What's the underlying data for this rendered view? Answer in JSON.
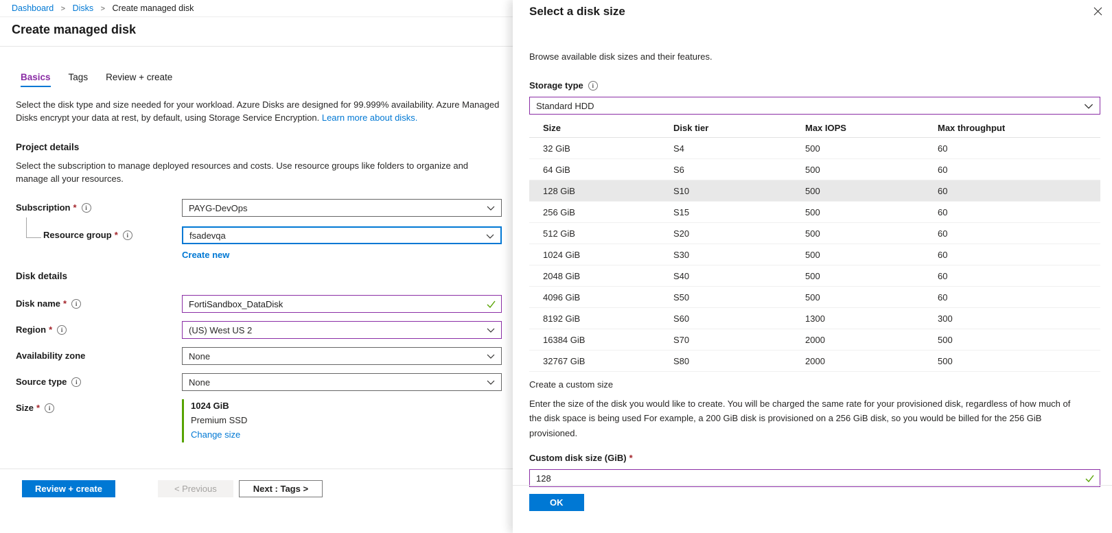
{
  "ui": {
    "required": "*",
    "breadcrumb_separator": ">"
  },
  "breadcrumb": {
    "dashboard": "Dashboard",
    "disks": "Disks",
    "current": "Create managed disk"
  },
  "page": {
    "title": "Create managed disk"
  },
  "tabs": {
    "basics": "Basics",
    "tags": "Tags",
    "review": "Review + create"
  },
  "intro": {
    "text": "Select the disk type and size needed for your workload. Azure Disks are designed for 99.999% availability. Azure Managed Disks encrypt your data at rest, by default, using Storage Service Encryption.",
    "link": "Learn more about disks."
  },
  "project_details": {
    "heading": "Project details",
    "description": "Select the subscription to manage deployed resources and costs. Use resource groups like folders to organize and manage all your resources.",
    "subscription": {
      "label": "Subscription",
      "value": "PAYG-DevOps"
    },
    "resource_group": {
      "label": "Resource group",
      "value": "fsadevqa",
      "create_new": "Create new"
    }
  },
  "disk_details": {
    "heading": "Disk details",
    "disk_name": {
      "label": "Disk name",
      "value": "FortiSandbox_DataDisk"
    },
    "region": {
      "label": "Region",
      "value": "(US) West US 2"
    },
    "availability_zone": {
      "label": "Availability zone",
      "value": "None"
    },
    "source_type": {
      "label": "Source type",
      "value": "None"
    },
    "size": {
      "label": "Size",
      "value": "1024 GiB",
      "tier": "Premium SSD",
      "change_link": "Change size"
    }
  },
  "footer": {
    "review_create": "Review + create",
    "previous": "< Previous",
    "next": "Next : Tags >"
  },
  "panel": {
    "title": "Select a disk size",
    "description": "Browse available disk sizes and their features.",
    "storage_type": {
      "label": "Storage type",
      "value": "Standard HDD"
    },
    "table": {
      "headers": {
        "size": "Size",
        "tier": "Disk tier",
        "iops": "Max IOPS",
        "throughput": "Max throughput"
      },
      "selected_size": "128 GiB",
      "rows": [
        {
          "size": "32 GiB",
          "tier": "S4",
          "iops": "500",
          "throughput": "60"
        },
        {
          "size": "64 GiB",
          "tier": "S6",
          "iops": "500",
          "throughput": "60"
        },
        {
          "size": "128 GiB",
          "tier": "S10",
          "iops": "500",
          "throughput": "60"
        },
        {
          "size": "256 GiB",
          "tier": "S15",
          "iops": "500",
          "throughput": "60"
        },
        {
          "size": "512 GiB",
          "tier": "S20",
          "iops": "500",
          "throughput": "60"
        },
        {
          "size": "1024 GiB",
          "tier": "S30",
          "iops": "500",
          "throughput": "60"
        },
        {
          "size": "2048 GiB",
          "tier": "S40",
          "iops": "500",
          "throughput": "60"
        },
        {
          "size": "4096 GiB",
          "tier": "S50",
          "iops": "500",
          "throughput": "60"
        },
        {
          "size": "8192 GiB",
          "tier": "S60",
          "iops": "1300",
          "throughput": "300"
        },
        {
          "size": "16384 GiB",
          "tier": "S70",
          "iops": "2000",
          "throughput": "500"
        },
        {
          "size": "32767 GiB",
          "tier": "S80",
          "iops": "2000",
          "throughput": "500"
        }
      ]
    },
    "custom": {
      "heading": "Create a custom size",
      "description": "Enter the size of the disk you would like to create. You will be charged the same rate for your provisioned disk, regardless of how much of the disk space is being used For example, a 200 GiB disk is provisioned on a 256 GiB disk, so you would be billed for the 256 GiB provisioned.",
      "label": "Custom disk size (GiB)",
      "value": "128"
    },
    "ok": "OK"
  },
  "colors": {
    "accent": "#0078d4",
    "focus_purple": "#8a2da5",
    "valid_green": "#57a300",
    "required_red": "#a4262c",
    "selected_row": "#e8e8e8"
  }
}
